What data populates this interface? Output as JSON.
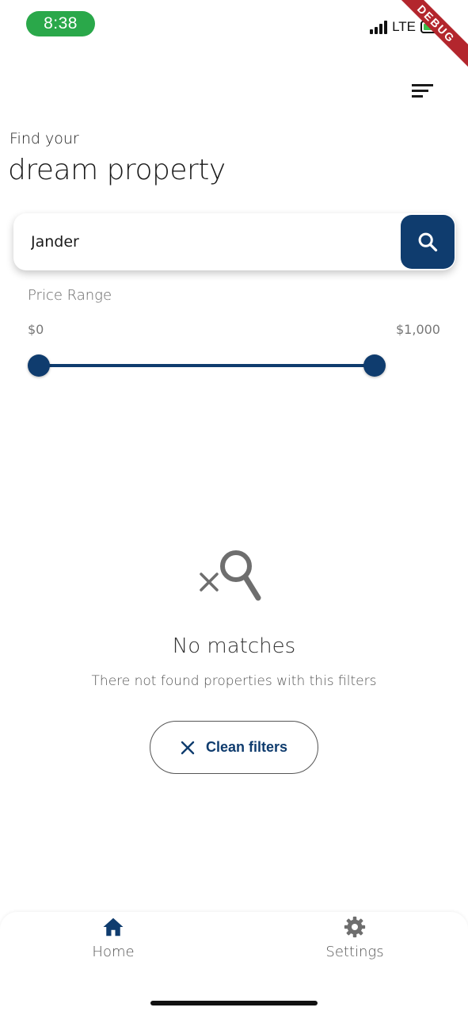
{
  "status_bar": {
    "time": "8:38",
    "network": "LTE",
    "debug_label": "DEBUG",
    "battery_color": "#3bbf4b",
    "time_pill_color": "#2aa84a"
  },
  "header": {
    "filter_icon": "filter-lines-icon",
    "subtitle": "Find your",
    "title": "dream property"
  },
  "search": {
    "value": "Jander",
    "button_icon": "search-icon"
  },
  "price_range": {
    "label": "Price Range",
    "min_label": "$0",
    "max_label": "$1,000",
    "range_start": 0,
    "range_end": 1000
  },
  "empty_state": {
    "icon": "search-off-icon",
    "title": "No matches",
    "description": "There not found properties with this filters",
    "clean_button": {
      "icon": "close-icon",
      "label": "Clean filters"
    }
  },
  "bottom_nav": {
    "items": [
      {
        "label": "Home",
        "icon": "home-icon",
        "active": true
      },
      {
        "label": "Settings",
        "icon": "gear-icon",
        "active": false
      }
    ]
  },
  "colors": {
    "primary": "#0f3c6e",
    "text": "#1a1a1a",
    "muted": "#666666",
    "icon_gray": "#6e6e6e"
  }
}
